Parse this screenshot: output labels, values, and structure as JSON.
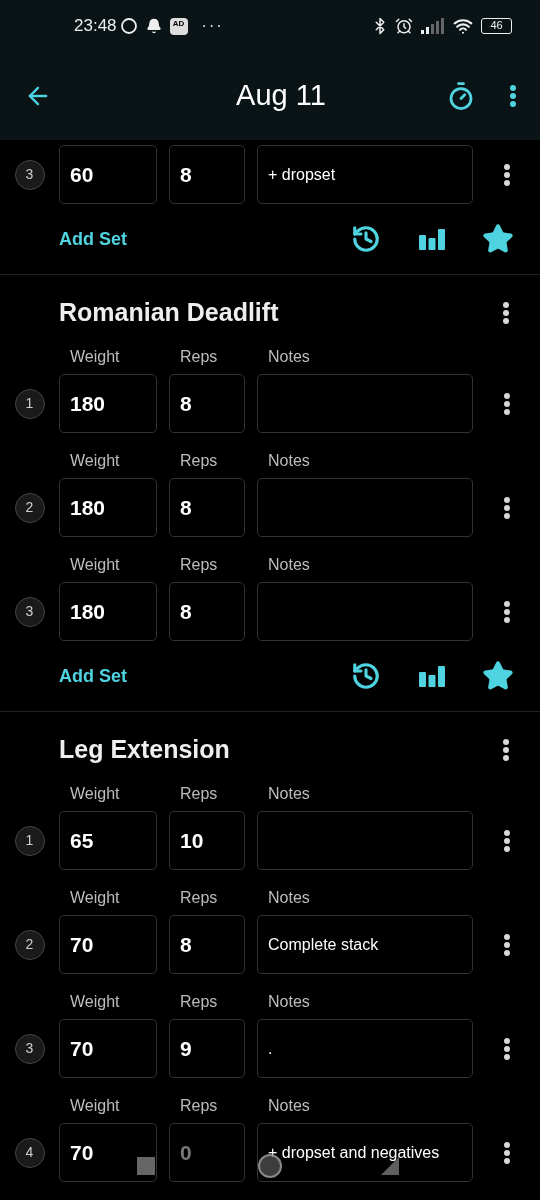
{
  "status_bar": {
    "time": "23:48",
    "ad_badge": "AD",
    "overflow": "···",
    "battery": "46"
  },
  "app_bar": {
    "title": "Aug 11"
  },
  "exercises": [
    {
      "sets": [
        {
          "number": "3",
          "weight": "60",
          "reps": "8",
          "notes": "+ dropset"
        }
      ],
      "add_set": "Add Set"
    },
    {
      "name": "Romanian Deadlift",
      "sets": [
        {
          "number": "1",
          "labels": {
            "weight": "Weight",
            "reps": "Reps",
            "notes": "Notes"
          },
          "weight": "180",
          "reps": "8"
        },
        {
          "number": "2",
          "labels": {
            "weight": "Weight",
            "reps": "Reps",
            "notes": "Notes"
          },
          "weight": "180",
          "reps": "8"
        },
        {
          "number": "3",
          "labels": {
            "weight": "Weight",
            "reps": "Reps",
            "notes": "Notes"
          },
          "weight": "180",
          "reps": "8"
        }
      ],
      "add_set": "Add Set"
    },
    {
      "name": "Leg Extension",
      "sets": [
        {
          "number": "1",
          "labels": {
            "weight": "Weight",
            "reps": "Reps",
            "notes": "Notes"
          },
          "weight": "65",
          "reps": "10"
        },
        {
          "number": "2",
          "labels": {
            "weight": "Weight",
            "reps": "Reps",
            "notes": "Notes"
          },
          "weight": "70",
          "reps": "8",
          "notes": "Complete stack"
        },
        {
          "number": "3",
          "labels": {
            "weight": "Weight",
            "reps": "Reps",
            "notes": "Notes"
          },
          "weight": "70",
          "reps": "9",
          "notes": "."
        },
        {
          "number": "4",
          "labels": {
            "weight": "Weight",
            "reps": "Reps",
            "notes": "Notes"
          },
          "weight": "70",
          "reps_placeholder": "0",
          "notes": "+ dropset and negatives"
        }
      ]
    }
  ]
}
